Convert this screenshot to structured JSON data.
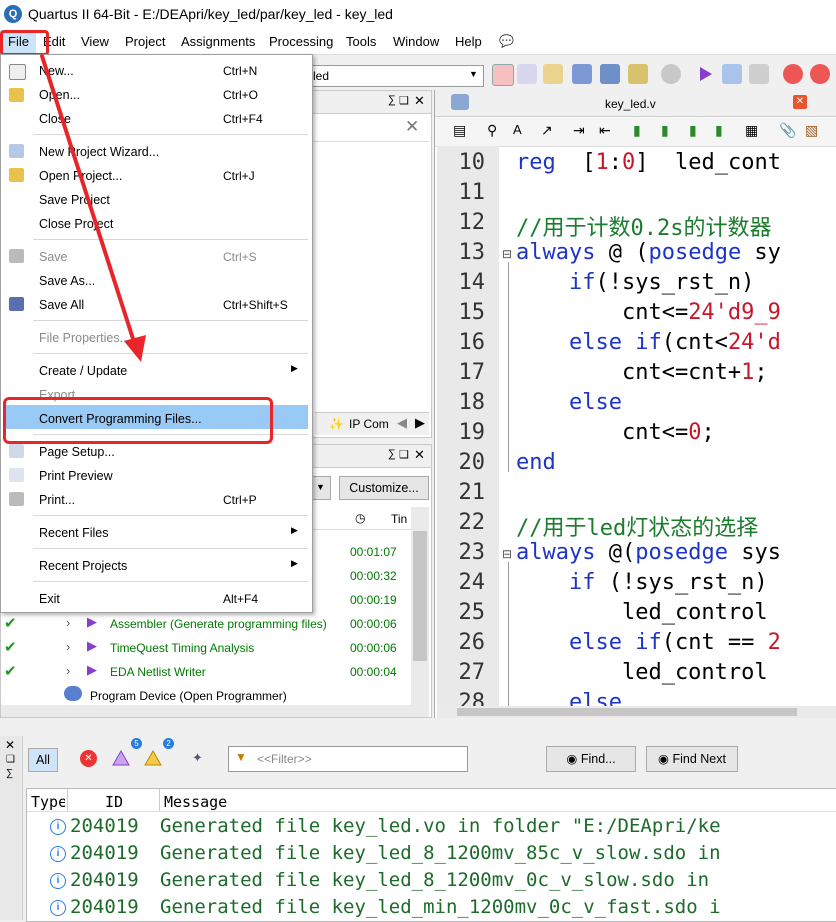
{
  "window": {
    "title": "Quartus II 64-Bit - E:/DEApri/key_led/par/key_led - key_led"
  },
  "menubar": {
    "items": [
      "File",
      "Edit",
      "View",
      "Project",
      "Assignments",
      "Processing",
      "Tools",
      "Window",
      "Help"
    ]
  },
  "toolbar": {
    "project_select": "led"
  },
  "file_menu": {
    "new": "New...",
    "new_sc": "Ctrl+N",
    "open": "Open...",
    "open_sc": "Ctrl+O",
    "close": "Close",
    "close_sc": "Ctrl+F4",
    "new_project_wizard": "New Project Wizard...",
    "open_project": "Open Project...",
    "open_project_sc": "Ctrl+J",
    "save_project": "Save Project",
    "close_project": "Close Project",
    "save": "Save",
    "save_sc": "Ctrl+S",
    "save_as": "Save As...",
    "save_all": "Save All",
    "save_all_sc": "Ctrl+Shift+S",
    "file_properties": "File Properties...",
    "create_update": "Create / Update",
    "export": "Export...",
    "convert_programming_files": "Convert Programming Files...",
    "page_setup": "Page Setup...",
    "print_preview": "Print Preview",
    "print": "Print...",
    "print_sc": "Ctrl+P",
    "recent_files": "Recent Files",
    "recent_projects": "Recent Projects",
    "exit": "Exit",
    "exit_sc": "Alt+F4"
  },
  "ip_tab": {
    "label": "IP Com"
  },
  "tasks": {
    "customize": "Customize...",
    "time_header": "Tin",
    "rows": [
      {
        "name": "",
        "time": "00:01:07"
      },
      {
        "name": "",
        "time": "00:00:32"
      },
      {
        "name": "",
        "time": "00:00:19"
      },
      {
        "name": "Assembler (Generate programming files)",
        "time": "00:00:06"
      },
      {
        "name": "TimeQuest Timing Analysis",
        "time": "00:00:06"
      },
      {
        "name": "EDA Netlist Writer",
        "time": "00:00:04"
      }
    ],
    "program_device": "Program Device (Open Programmer)"
  },
  "editor": {
    "tab": "key_led.v",
    "lines": [
      {
        "n": "10",
        "text": "reg  [1:0]  led_cont"
      },
      {
        "n": "11",
        "text": ""
      },
      {
        "n": "12",
        "text": "//用于计数0.2s的计数器"
      },
      {
        "n": "13",
        "text": "always @ (posedge sy"
      },
      {
        "n": "14",
        "text": "    if(!sys_rst_n)"
      },
      {
        "n": "15",
        "text": "        cnt<=24'd9_9"
      },
      {
        "n": "16",
        "text": "    else if(cnt<24'd"
      },
      {
        "n": "17",
        "text": "        cnt<=cnt+1;"
      },
      {
        "n": "18",
        "text": "    else"
      },
      {
        "n": "19",
        "text": "        cnt<=0;"
      },
      {
        "n": "20",
        "text": "end"
      },
      {
        "n": "21",
        "text": ""
      },
      {
        "n": "22",
        "text": "//用于led灯状态的选择"
      },
      {
        "n": "23",
        "text": "always @(posedge sys"
      },
      {
        "n": "24",
        "text": "    if (!sys_rst_n)"
      },
      {
        "n": "25",
        "text": "        led_control"
      },
      {
        "n": "26",
        "text": "    else if(cnt == 2"
      },
      {
        "n": "27",
        "text": "        led_control"
      },
      {
        "n": "28",
        "text": "    else"
      }
    ]
  },
  "messages": {
    "all": "All",
    "badge_warn": "5",
    "badge_info": "2",
    "filter_placeholder": "<<Filter>>",
    "find": "Find...",
    "find_next": "Find Next",
    "col_type": "Type",
    "col_id": "ID",
    "col_message": "Message",
    "rows": [
      {
        "id": "204019",
        "text": "Generated file key_led.vo in folder \"E:/DEApri/ke"
      },
      {
        "id": "204019",
        "text": "Generated file key_led_8_1200mv_85c_v_slow.sdo in"
      },
      {
        "id": "204019",
        "text": "Generated file key_led_8_1200mv_0c_v_slow.sdo in"
      },
      {
        "id": "204019",
        "text": "Generated file key_led_min_1200mv_0c_v_fast.sdo i"
      }
    ]
  },
  "colors": {
    "highlight_box": "#e8262a",
    "menu_selected": "#99c9f5",
    "keyword": "#1d34c8",
    "comment": "#1c7c2e"
  }
}
